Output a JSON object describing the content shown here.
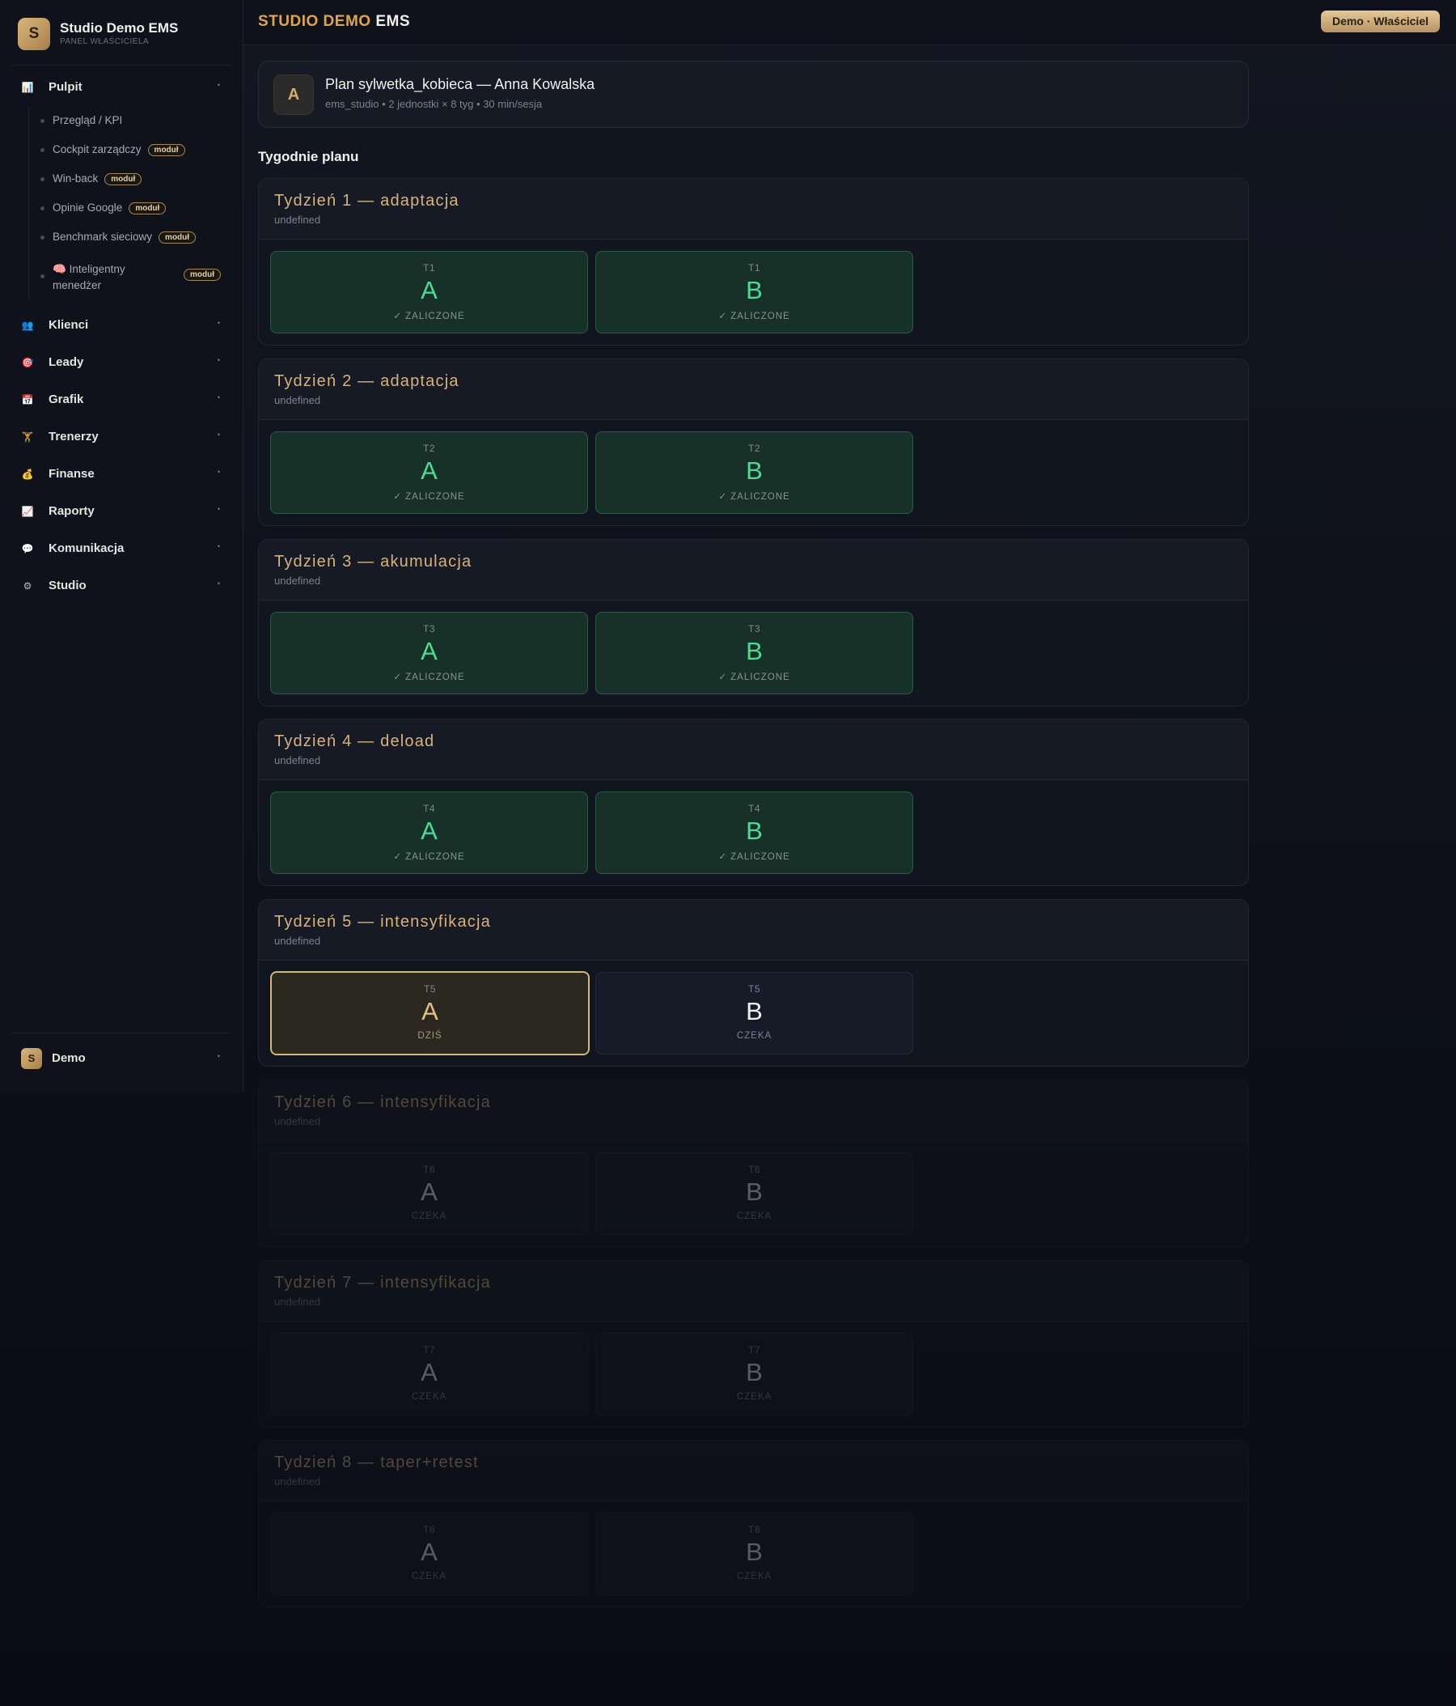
{
  "brand": {
    "logo_letter": "S",
    "name": "Studio Demo EMS",
    "subtitle": "PANEL WŁAŚCICIELA"
  },
  "topbar": {
    "title_part1": "STUDIO DEMO",
    "title_part2": "EMS",
    "role": "Demo · Właściciel"
  },
  "sidebar": {
    "pulpit": {
      "icon": "📊",
      "label": "Pulpit",
      "chevron": "•"
    },
    "sub_items": [
      {
        "label": "Przegląd / KPI",
        "badge": ""
      },
      {
        "label": "Cockpit zarządczy",
        "badge": "moduł"
      },
      {
        "label": "Win-back",
        "badge": "moduł"
      },
      {
        "label": "Opinie Google",
        "badge": "moduł"
      },
      {
        "label": "Benchmark sieciowy",
        "badge": "moduł"
      },
      {
        "icon": "🧠",
        "label": "Inteligentny menedżer",
        "badge": "moduł"
      }
    ],
    "items": [
      {
        "icon": "👥",
        "label": "Klienci",
        "chevron": "•"
      },
      {
        "icon": "🎯",
        "label": "Leady",
        "chevron": "•"
      },
      {
        "icon": "📅",
        "label": "Grafik",
        "chevron": "•"
      },
      {
        "icon": "🏋",
        "label": "Trenerzy",
        "chevron": "•"
      },
      {
        "icon": "💰",
        "label": "Finanse",
        "chevron": "•"
      },
      {
        "icon": "📈",
        "label": "Raporty",
        "chevron": "•"
      },
      {
        "icon": "💬",
        "label": "Komunikacja",
        "chevron": "•"
      },
      {
        "icon": "⚙",
        "label": "Studio",
        "chevron": "•"
      }
    ],
    "user": {
      "avatar": "S",
      "name": "Demo",
      "chevron": "•"
    }
  },
  "plan": {
    "avatar": "A",
    "title": "Plan sylwetka_kobieca — Anna Kowalska",
    "meta": "ems_studio • 2 jednostki × 8 tyg • 30 min/sesja"
  },
  "section_title": "Tygodnie planu",
  "weeks": [
    {
      "title": "Tydzień 1 — adaptacja",
      "sub": "undefined",
      "a": {
        "week": "T1",
        "letter": "A",
        "status": "✓ ZALICZONE"
      },
      "b": {
        "week": "T1",
        "letter": "B",
        "status": "✓ ZALICZONE"
      }
    },
    {
      "title": "Tydzień 2 — adaptacja",
      "sub": "undefined",
      "a": {
        "week": "T2",
        "letter": "A",
        "status": "✓ ZALICZONE"
      },
      "b": {
        "week": "T2",
        "letter": "B",
        "status": "✓ ZALICZONE"
      }
    },
    {
      "title": "Tydzień 3 — akumulacja",
      "sub": "undefined",
      "a": {
        "week": "T3",
        "letter": "A",
        "status": "✓ ZALICZONE"
      },
      "b": {
        "week": "T3",
        "letter": "B",
        "status": "✓ ZALICZONE"
      }
    },
    {
      "title": "Tydzień 4 — deload",
      "sub": "undefined",
      "a": {
        "week": "T4",
        "letter": "A",
        "status": "✓ ZALICZONE"
      },
      "b": {
        "week": "T4",
        "letter": "B",
        "status": "✓ ZALICZONE"
      }
    },
    {
      "title": "Tydzień 5 — intensyfikacja",
      "sub": "undefined",
      "a": {
        "week": "T5",
        "letter": "A",
        "status": "DZIŚ"
      },
      "b": {
        "week": "T5",
        "letter": "B",
        "status": "CZEKA"
      }
    },
    {
      "title": "Tydzień 6 — intensyfikacja",
      "sub": "undefined",
      "a": {
        "week": "T6",
        "letter": "A",
        "status": "CZEKA"
      },
      "b": {
        "week": "T6",
        "letter": "B",
        "status": "CZEKA"
      }
    },
    {
      "title": "Tydzień 7 — intensyfikacja",
      "sub": "undefined",
      "a": {
        "week": "T7",
        "letter": "A",
        "status": "CZEKA"
      },
      "b": {
        "week": "T7",
        "letter": "B",
        "status": "CZEKA"
      }
    },
    {
      "title": "Tydzień 8 — taper+retest",
      "sub": "undefined",
      "a": {
        "week": "T8",
        "letter": "A",
        "status": "CZEKA"
      },
      "b": {
        "week": "T8",
        "letter": "B",
        "status": "CZEKA"
      }
    }
  ],
  "colors": {
    "accent_gold": "#d6b674",
    "done_green": "#4bdc94",
    "brand_orange": "#e0a548"
  }
}
